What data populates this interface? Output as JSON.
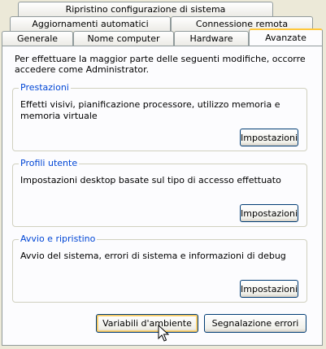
{
  "tabs": {
    "row1": [
      {
        "label": "Ripristino configurazione di sistema"
      }
    ],
    "row2": [
      {
        "label": "Aggiornamenti automatici"
      },
      {
        "label": "Connessione remota"
      }
    ],
    "row3": [
      {
        "label": "Generale"
      },
      {
        "label": "Nome computer"
      },
      {
        "label": "Hardware"
      },
      {
        "label": "Avanzate",
        "active": true
      }
    ]
  },
  "intro_text": "Per effettuare la maggior parte delle seguenti modifiche, occorre accedere come Administrator.",
  "groups": {
    "performance": {
      "title": "Prestazioni",
      "description": "Effetti visivi, pianificazione processore, utilizzo memoria e memoria virtuale",
      "button": "Impostazioni"
    },
    "user_profiles": {
      "title": "Profili utente",
      "description": "Impostazioni desktop basate sul tipo di accesso effettuato",
      "button": "Impostazioni"
    },
    "startup_recovery": {
      "title": "Avvio e ripristino",
      "description": "Avvio del sistema, errori di sistema e informazioni di debug",
      "button": "Impostazioni"
    }
  },
  "buttons": {
    "env_vars": "Variabili d'ambiente",
    "error_reporting": "Segnalazione errori"
  },
  "colors": {
    "dialog_bg": "#ece9d8",
    "panel_bg": "#fcfcfe",
    "group_title": "#0046d5",
    "button_border": "#003c74",
    "active_tab_accent": "#ffc83c"
  }
}
